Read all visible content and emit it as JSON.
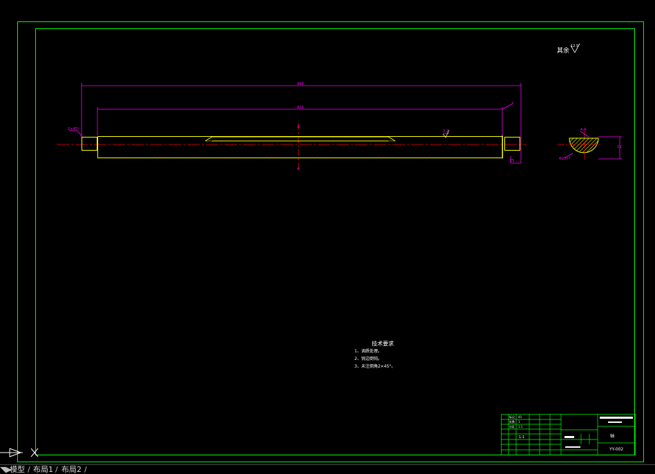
{
  "drawing": {
    "surface_finish_note": "其余",
    "surface_finish_value": "12.5",
    "overall_length_dim": "880",
    "inner_length_dim": "820",
    "right_end_dim": "2",
    "left_chamfer_label": "2×45°",
    "section_marker_label": "A",
    "roughness_label": "3.2",
    "end_width_dim": "25",
    "section_label": "A-A",
    "section_height_dim": "15",
    "section_diameter_label": "Φ20h7",
    "tech_requirements": {
      "title": "技术要求",
      "items": [
        "1、调质处理。",
        "2、锐边倒钝。",
        "3、未注倒角2×45°。"
      ]
    },
    "title_block": {
      "drawing_number": "YY-002",
      "part_name": "轴",
      "scale": "1:1",
      "material": "45",
      "rows": [
        "标记",
        "处数",
        "分区"
      ],
      "small_values": [
        "45",
        "1",
        "1:1"
      ]
    }
  },
  "layout_tabs": {
    "items": [
      {
        "id": "model",
        "label": "模型"
      },
      {
        "id": "layout1",
        "label": "布局1"
      },
      {
        "id": "layout2",
        "label": "布局2"
      }
    ]
  },
  "ucs": {
    "x_label": "X"
  },
  "colors": {
    "background": "#000000",
    "frame": "#00ff00",
    "part_outline": "#ffff00",
    "dimension": "#ff00ff",
    "center_line": "#ff0000",
    "hatch": "#ffff00",
    "text": "#ffffff"
  }
}
